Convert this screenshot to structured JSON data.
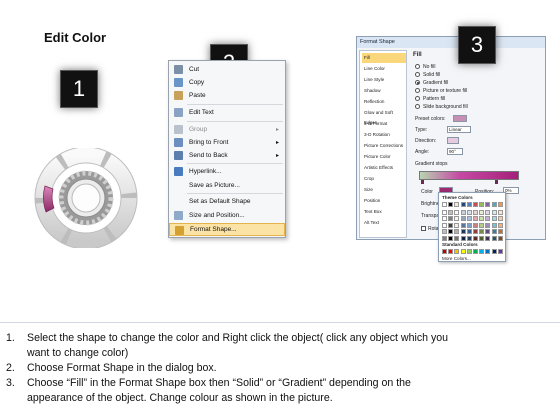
{
  "title": "Edit Color",
  "steps": [
    "1",
    "2",
    "3"
  ],
  "context_menu": {
    "items": [
      {
        "label": "Cut",
        "icon": "scissors-icon",
        "submenu": false
      },
      {
        "label": "Copy",
        "icon": "copy-icon",
        "submenu": false
      },
      {
        "label": "Paste",
        "icon": "paste-icon",
        "submenu": false
      },
      {
        "label": "Edit Text",
        "icon": "edit-text-icon",
        "submenu": false
      },
      {
        "label": "Group",
        "icon": "group-icon",
        "submenu": true
      },
      {
        "label": "Bring to Front",
        "icon": "bring-to-front-icon",
        "submenu": true
      },
      {
        "label": "Send to Back",
        "icon": "send-to-back-icon",
        "submenu": true
      },
      {
        "label": "Hyperlink...",
        "icon": "hyperlink-icon",
        "submenu": false
      },
      {
        "label": "Save as Picture...",
        "icon": "",
        "submenu": false
      },
      {
        "label": "Set as Default Shape",
        "icon": "",
        "submenu": false
      },
      {
        "label": "Size and Position...",
        "icon": "size-position-icon",
        "submenu": false
      },
      {
        "label": "Format Shape...",
        "icon": "format-shape-icon",
        "submenu": false,
        "highlighted": true
      }
    ]
  },
  "dialog": {
    "title": "Format Shape",
    "nav": [
      "Fill",
      "Line Color",
      "Line Style",
      "Shadow",
      "Reflection",
      "Glow and Soft Edges",
      "3-D Format",
      "3-D Rotation",
      "Picture Corrections",
      "Picture Color",
      "Artistic Effects",
      "Crop",
      "Size",
      "Position",
      "Text Box",
      "Alt Text"
    ],
    "selected_nav": "Fill",
    "pane_heading": "Fill",
    "fill_options": [
      "No fill",
      "Solid fill",
      "Gradient fill",
      "Picture or texture fill",
      "Pattern fill",
      "Slide background fill"
    ],
    "selected_fill": "Gradient fill",
    "preset_label": "Preset colors:",
    "type_label": "Type:",
    "type_value": "Linear",
    "direction_label": "Direction:",
    "angle_label": "Angle:",
    "angle_value": "90°",
    "stops_label": "Gradient stops",
    "color_label": "Color",
    "position_label": "Position:",
    "position_value": "0%",
    "brightness_label": "Brightness:",
    "transparency_label": "Transparency:",
    "rotate_label": "Rotate with shape"
  },
  "palette": {
    "theme_label": "Theme Colors",
    "standard_label": "Standard Colors",
    "more_label": "More Colors...",
    "theme_top": [
      "#ffffff",
      "#000000",
      "#eeece1",
      "#1f497d",
      "#4f81bd",
      "#c0504d",
      "#9bbb59",
      "#8064a2",
      "#4bacc6",
      "#f79646"
    ],
    "standard": [
      "#c00000",
      "#ff0000",
      "#ffc000",
      "#ffff00",
      "#92d050",
      "#00b050",
      "#00b0f0",
      "#0070c0",
      "#002060",
      "#7030a0"
    ]
  },
  "instructions": [
    {
      "num": "1.",
      "line1": "Select the shape to change the color and Right click the object( click any object which you",
      "line2": "want to change color)"
    },
    {
      "num": "2.",
      "line1": "Choose Format Shape in the dialog box.",
      "line2": ""
    },
    {
      "num": "3.",
      "line1": "Choose “Fill” in the Format Shape box then “Solid” or “Gradient” depending on the",
      "line2": "appearance of the object. Change colour as shown in the picture."
    }
  ],
  "colors": {
    "accent": "#b5427f",
    "highlight": "#fbd77b"
  }
}
